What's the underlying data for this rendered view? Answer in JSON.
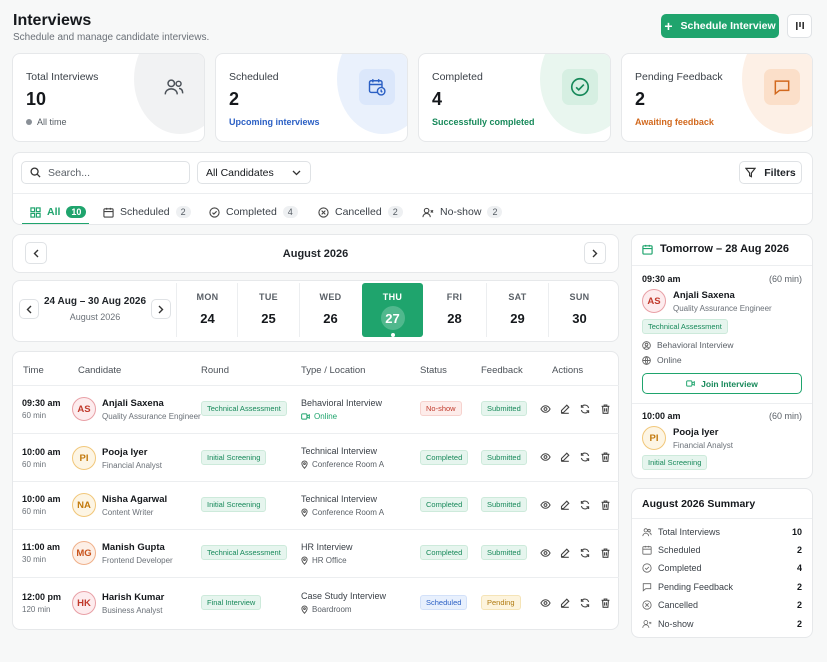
{
  "header": {
    "title": "Interviews",
    "subtitle": "Schedule and manage candidate interviews.",
    "schedule_button": "Schedule Interview"
  },
  "stats": [
    {
      "label": "Total Interviews",
      "value": "10",
      "footer": "All time",
      "accent": "#6b7178",
      "icon": "users-icon"
    },
    {
      "label": "Scheduled",
      "value": "2",
      "footer": "Upcoming interviews",
      "accent": "#2a5fc4",
      "icon": "calendar-clock-icon"
    },
    {
      "label": "Completed",
      "value": "4",
      "footer": "Successfully completed",
      "accent": "#17895a",
      "icon": "check-circle-icon"
    },
    {
      "label": "Pending Feedback",
      "value": "2",
      "footer": "Awaiting feedback",
      "accent": "#d2691e",
      "icon": "message-icon"
    }
  ],
  "filters": {
    "search_placeholder": "Search...",
    "candidate_select": "All Candidates",
    "filters_button": "Filters"
  },
  "tabs": [
    {
      "label": "All",
      "count": "10",
      "icon": "grid-icon"
    },
    {
      "label": "Scheduled",
      "count": "2",
      "icon": "calendar-icon"
    },
    {
      "label": "Completed",
      "count": "4",
      "icon": "check-circle-icon"
    },
    {
      "label": "Cancelled",
      "count": "2",
      "icon": "x-circle-icon"
    },
    {
      "label": "No-show",
      "count": "2",
      "icon": "user-x-icon"
    }
  ],
  "calendar": {
    "month": "August 2026",
    "week_range": "24 Aug – 30 Aug 2026",
    "week_month": "August 2026",
    "days": [
      {
        "name": "MON",
        "date": "24"
      },
      {
        "name": "TUE",
        "date": "25"
      },
      {
        "name": "WED",
        "date": "26"
      },
      {
        "name": "THU",
        "date": "27"
      },
      {
        "name": "FRI",
        "date": "28"
      },
      {
        "name": "SAT",
        "date": "29"
      },
      {
        "name": "SUN",
        "date": "30"
      }
    ]
  },
  "table": {
    "headers": [
      "Time",
      "Candidate",
      "Round",
      "Type / Location",
      "Status",
      "Feedback",
      "Actions"
    ],
    "rows": [
      {
        "time": "09:30 am",
        "duration": "60 min",
        "initials": "AS",
        "name": "Anjali Saxena",
        "role": "Quality Assurance Engineer",
        "round": "Technical Assessment",
        "type": "Behavioral Interview",
        "location": "Online",
        "status": "No-show",
        "feedback": "Submitted"
      },
      {
        "time": "10:00 am",
        "duration": "60 min",
        "initials": "PI",
        "name": "Pooja Iyer",
        "role": "Financial Analyst",
        "round": "Initial Screening",
        "type": "Technical Interview",
        "location": "Conference Room A",
        "status": "Completed",
        "feedback": "Submitted"
      },
      {
        "time": "10:00 am",
        "duration": "60 min",
        "initials": "NA",
        "name": "Nisha Agarwal",
        "role": "Content Writer",
        "round": "Initial Screening",
        "type": "Technical Interview",
        "location": "Conference Room A",
        "status": "Completed",
        "feedback": "Submitted"
      },
      {
        "time": "11:00 am",
        "duration": "30 min",
        "initials": "MG",
        "name": "Manish Gupta",
        "role": "Frontend Developer",
        "round": "Technical Assessment",
        "type": "HR Interview",
        "location": "HR Office",
        "status": "Completed",
        "feedback": "Submitted"
      },
      {
        "time": "12:00 pm",
        "duration": "120 min",
        "initials": "HK",
        "name": "Harish Kumar",
        "role": "Business Analyst",
        "round": "Final Interview",
        "type": "Case Study Interview",
        "location": "Boardroom",
        "status": "Scheduled",
        "feedback": "Pending"
      }
    ]
  },
  "tomorrow": {
    "title": "Tomorrow – 28 Aug 2026",
    "items": [
      {
        "time": "09:30 am",
        "duration": "(60 min)",
        "initials": "AS",
        "name": "Anjali Saxena",
        "role": "Quality Assurance Engineer",
        "round": "Technical Assessment",
        "type": "Behavioral Interview",
        "location": "Online",
        "join": "Join Interview"
      },
      {
        "time": "10:00 am",
        "duration": "(60 min)",
        "initials": "PI",
        "name": "Pooja Iyer",
        "role": "Financial Analyst",
        "round": "Initial Screening"
      }
    ]
  },
  "summary": {
    "title": "August 2026 Summary",
    "items": [
      {
        "label": "Total Interviews",
        "value": "10",
        "icon": "users-icon"
      },
      {
        "label": "Scheduled",
        "value": "2",
        "icon": "calendar-icon"
      },
      {
        "label": "Completed",
        "value": "4",
        "icon": "check-circle-icon"
      },
      {
        "label": "Pending Feedback",
        "value": "2",
        "icon": "message-icon"
      },
      {
        "label": "Cancelled",
        "value": "2",
        "icon": "x-circle-icon"
      },
      {
        "label": "No-show",
        "value": "2",
        "icon": "user-x-icon"
      }
    ]
  }
}
